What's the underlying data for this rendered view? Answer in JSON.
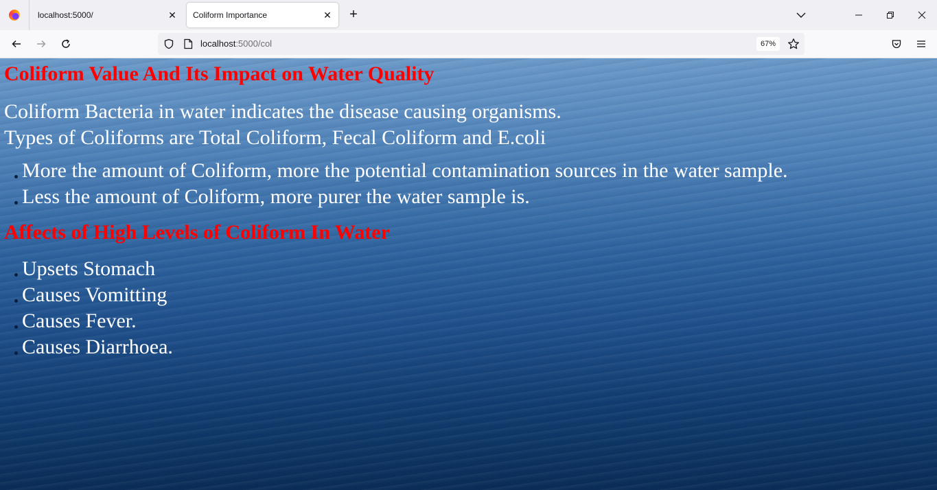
{
  "browser": {
    "tabs": [
      {
        "title": "localhost:5000/"
      },
      {
        "title": "Coliform Importance"
      }
    ],
    "url_host": "localhost",
    "url_path": ":5000/col",
    "zoom": "67%"
  },
  "content": {
    "title": "Coliform Value And Its Impact on Water Quality",
    "intro_line1": "Coliform Bacteria in water indicates the disease causing organisms.",
    "intro_line2": "Types of Coliforms are Total Coliform, Fecal Coliform and E.coli",
    "points": [
      "More the amount of Coliform, more the potential contamination sources in the water sample.",
      "Less the amount of Coliform, more purer the water sample is."
    ],
    "affects_heading": "Affects of High Levels of Coliform In Water",
    "affects": [
      "Upsets Stomach",
      "Causes Vomitting",
      "Causes Fever.",
      "Causes Diarrhoea."
    ]
  },
  "colors": {
    "heading": "#ff0000",
    "body_text": "#ffffff"
  }
}
